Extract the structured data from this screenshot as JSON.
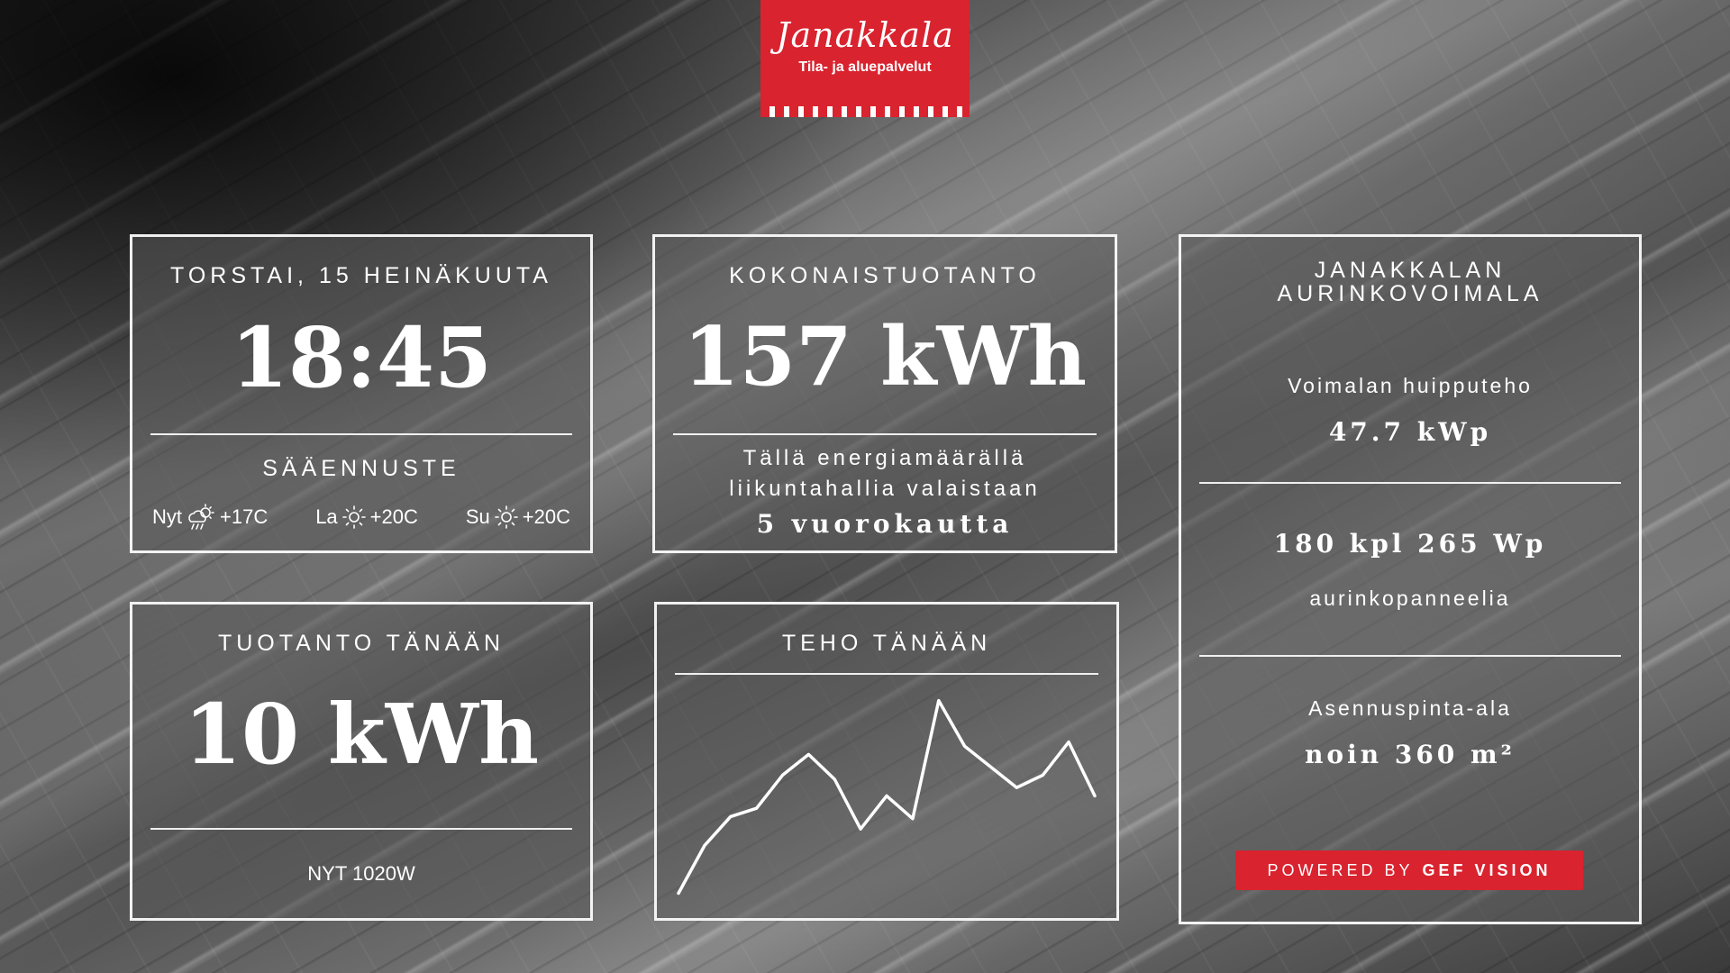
{
  "logo": {
    "name": "Janakkala",
    "subtitle": "Tila- ja aluepalvelut"
  },
  "date_panel": {
    "date": "TORSTAI, 15 HEINÄKUUTA",
    "time": "18:45",
    "forecast_title": "SÄÄENNUSTE",
    "forecast": [
      {
        "day": "Nyt",
        "icon": "rain-sun-icon",
        "temp": "+17C"
      },
      {
        "day": "La",
        "icon": "sun-icon",
        "temp": "+20C"
      },
      {
        "day": "Su",
        "icon": "sun-icon",
        "temp": "+20C"
      }
    ]
  },
  "total_panel": {
    "title": "KOKONAISTUOTANTO",
    "value": "157 kWh",
    "desc_line1": "Tällä energiamäärällä",
    "desc_line2": "liikuntahallia valaistaan",
    "highlight": "5 vuorokautta"
  },
  "today_panel": {
    "title": "TUOTANTO TÄNÄÄN",
    "value": "10 kWh",
    "now": "NYT 1020W"
  },
  "power_panel": {
    "title": "TEHO TÄNÄÄN"
  },
  "chart_data": {
    "type": "line",
    "values": [
      0.05,
      0.28,
      0.42,
      0.46,
      0.62,
      0.72,
      0.6,
      0.36,
      0.52,
      0.41,
      0.98,
      0.76,
      0.66,
      0.56,
      0.62,
      0.78,
      0.52
    ],
    "ylim": [
      0,
      1
    ],
    "grid": false
  },
  "plant_panel": {
    "title_line1": "JANAKKALAN",
    "title_line2": "AURINKOVOIMALA",
    "peak_label": "Voimalan huipputeho",
    "peak_value": "47.7 kWp",
    "panels_value": "180 kpl 265 Wp",
    "panels_label": "aurinkopanneelia",
    "area_label": "Asennuspinta-ala",
    "area_value": "noin 360 m²",
    "powered_prefix": "POWERED BY",
    "powered_brand": "GEF VISION"
  },
  "colors": {
    "brand_red": "#d9232f",
    "panel_border": "#ffffff"
  }
}
